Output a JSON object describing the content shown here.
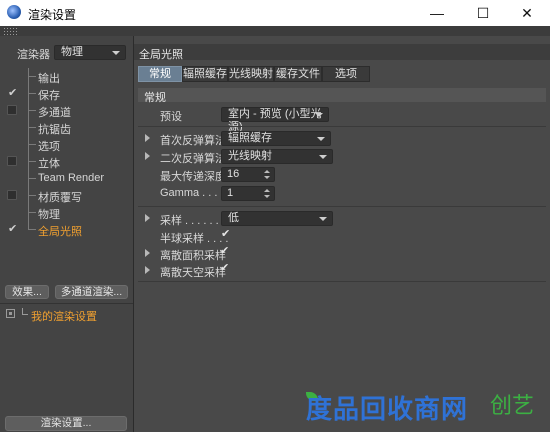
{
  "window": {
    "title": "渲染设置",
    "minimize_glyph": "—",
    "maximize_glyph": "☐",
    "close_glyph": "✕"
  },
  "sidebar": {
    "renderer_label": "渲染器",
    "renderer_value": "物理",
    "items": [
      {
        "label": "输出",
        "checkbox": "none",
        "check_glyph": ""
      },
      {
        "label": "保存",
        "checkbox": "checked",
        "check_glyph": "✔"
      },
      {
        "label": "多通道",
        "checkbox": "unchecked",
        "check_glyph": ""
      },
      {
        "label": "抗锯齿",
        "checkbox": "none",
        "check_glyph": ""
      },
      {
        "label": "选项",
        "checkbox": "none",
        "check_glyph": ""
      },
      {
        "label": "立体",
        "checkbox": "unchecked",
        "check_glyph": ""
      },
      {
        "label": "Team Render",
        "checkbox": "none",
        "check_glyph": ""
      },
      {
        "label": "材质覆写",
        "checkbox": "unchecked",
        "check_glyph": ""
      },
      {
        "label": "物理",
        "checkbox": "none",
        "check_glyph": ""
      },
      {
        "label": "全局光照",
        "checkbox": "checked",
        "check_glyph": "✔",
        "active": true
      }
    ],
    "effects_button": "效果...",
    "multipass_button": "多通道渲染...",
    "render_settings_item": "我的渲染设置",
    "render_settings_button": "渲染设置..."
  },
  "panel": {
    "title": "全局光照",
    "tabs": [
      "常规",
      "辐照缓存",
      "光线映射",
      "缓存文件",
      "选项"
    ],
    "active_tab": "常规",
    "section_title": "常规",
    "preset_label": "预设",
    "preset_value": "室内 - 预览 (小型光源)",
    "primary_label": "首次反弹算法",
    "primary_value": "辐照缓存",
    "secondary_label": "二次反弹算法",
    "secondary_value": "光线映射",
    "max_depth_label": "最大传递深度",
    "max_depth_value": "16",
    "gamma_label": "Gamma . . . .",
    "gamma_value": "1",
    "sampling_label": "采样 . . . . . . .",
    "sampling_value": "低",
    "hemi_label": "半球采样 . . . .",
    "hemi_check": "✔",
    "discrete_area_label": "离散面积采样",
    "discrete_area_check": "✔",
    "discrete_sky_label": "离散天空采样",
    "discrete_sky_check": "✔"
  },
  "watermark": {
    "text": "度品回收商网",
    "suffix": "创艺"
  }
}
